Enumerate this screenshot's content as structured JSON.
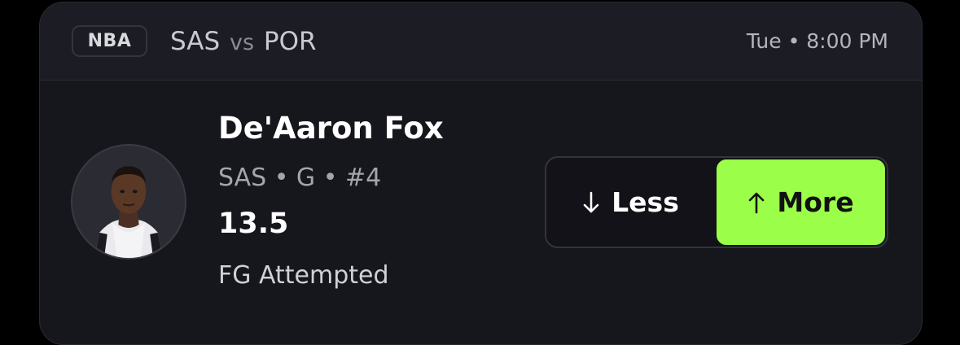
{
  "header": {
    "league": "NBA",
    "team_home": "SAS",
    "vs_label": "vs",
    "team_away": "POR",
    "game_time": "Tue • 8:00 PM"
  },
  "player": {
    "name": "De'Aaron Fox",
    "meta": "SAS • G • #4",
    "line": "13.5",
    "stat": "FG Attempted"
  },
  "picks": {
    "less_label": "Less",
    "more_label": "More"
  },
  "colors": {
    "more_accent": "#9bff4a",
    "card_bg": "#16161d",
    "header_bg": "#1c1c24"
  },
  "icons": {
    "less": "arrow-down-icon",
    "more": "arrow-up-icon"
  }
}
